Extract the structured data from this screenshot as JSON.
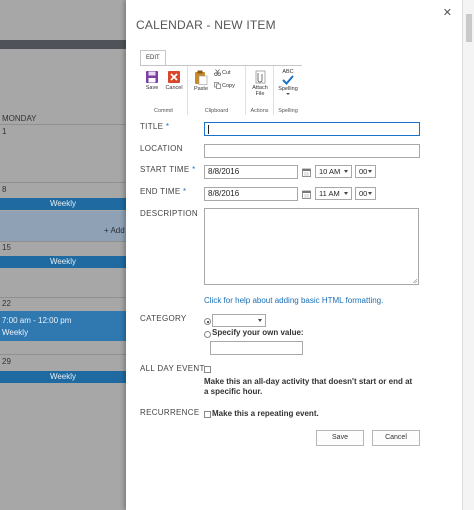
{
  "background": {
    "column_header": "MONDAY",
    "day_numbers": [
      "1",
      "8",
      "15",
      "22",
      "29"
    ],
    "weekly_label": "Weekly",
    "add_label": "+ Add",
    "event_time": "7:00 am - 12:00 pm",
    "event_title": "Weekly"
  },
  "dialog": {
    "title": "CALENDAR - NEW ITEM",
    "close_glyph": "✕"
  },
  "ribbon": {
    "tab": "EDIT",
    "save": "Save",
    "cancel": "Cancel",
    "paste": "Paste",
    "cut": "Cut",
    "copy": "Copy",
    "attach": "Attach File",
    "spelling": "Spelling",
    "abc": "ABC",
    "groups": {
      "commit": "Commit",
      "clipboard": "Clipboard",
      "actions": "Actions",
      "spelling": "Spelling"
    }
  },
  "form": {
    "title_label": "TITLE",
    "required_mark": "*",
    "title_value": "",
    "location_label": "LOCATION",
    "location_value": "",
    "start_label": "START TIME",
    "start_date": "8/8/2016",
    "start_hour": "10 AM",
    "start_min": "00",
    "end_label": "END TIME",
    "end_date": "8/8/2016",
    "end_hour": "11 AM",
    "end_min": "00",
    "description_label": "DESCRIPTION",
    "help_link": "Click for help about adding basic HTML formatting.",
    "category_label": "CATEGORY",
    "category_value": "",
    "specify_label": "Specify your own value:",
    "specify_value": "",
    "allday_label": "ALL DAY EVENT",
    "allday_text": "Make this an all-day activity that doesn't start or end at a specific hour.",
    "recurrence_label": "RECURRENCE",
    "recurrence_text": "Make this a repeating event.",
    "save_button": "Save",
    "cancel_button": "Cancel"
  },
  "colors": {
    "accent": "#1a73c7",
    "calendar_bar": "#1f6aa0",
    "overlay": "#a7a7a7"
  }
}
